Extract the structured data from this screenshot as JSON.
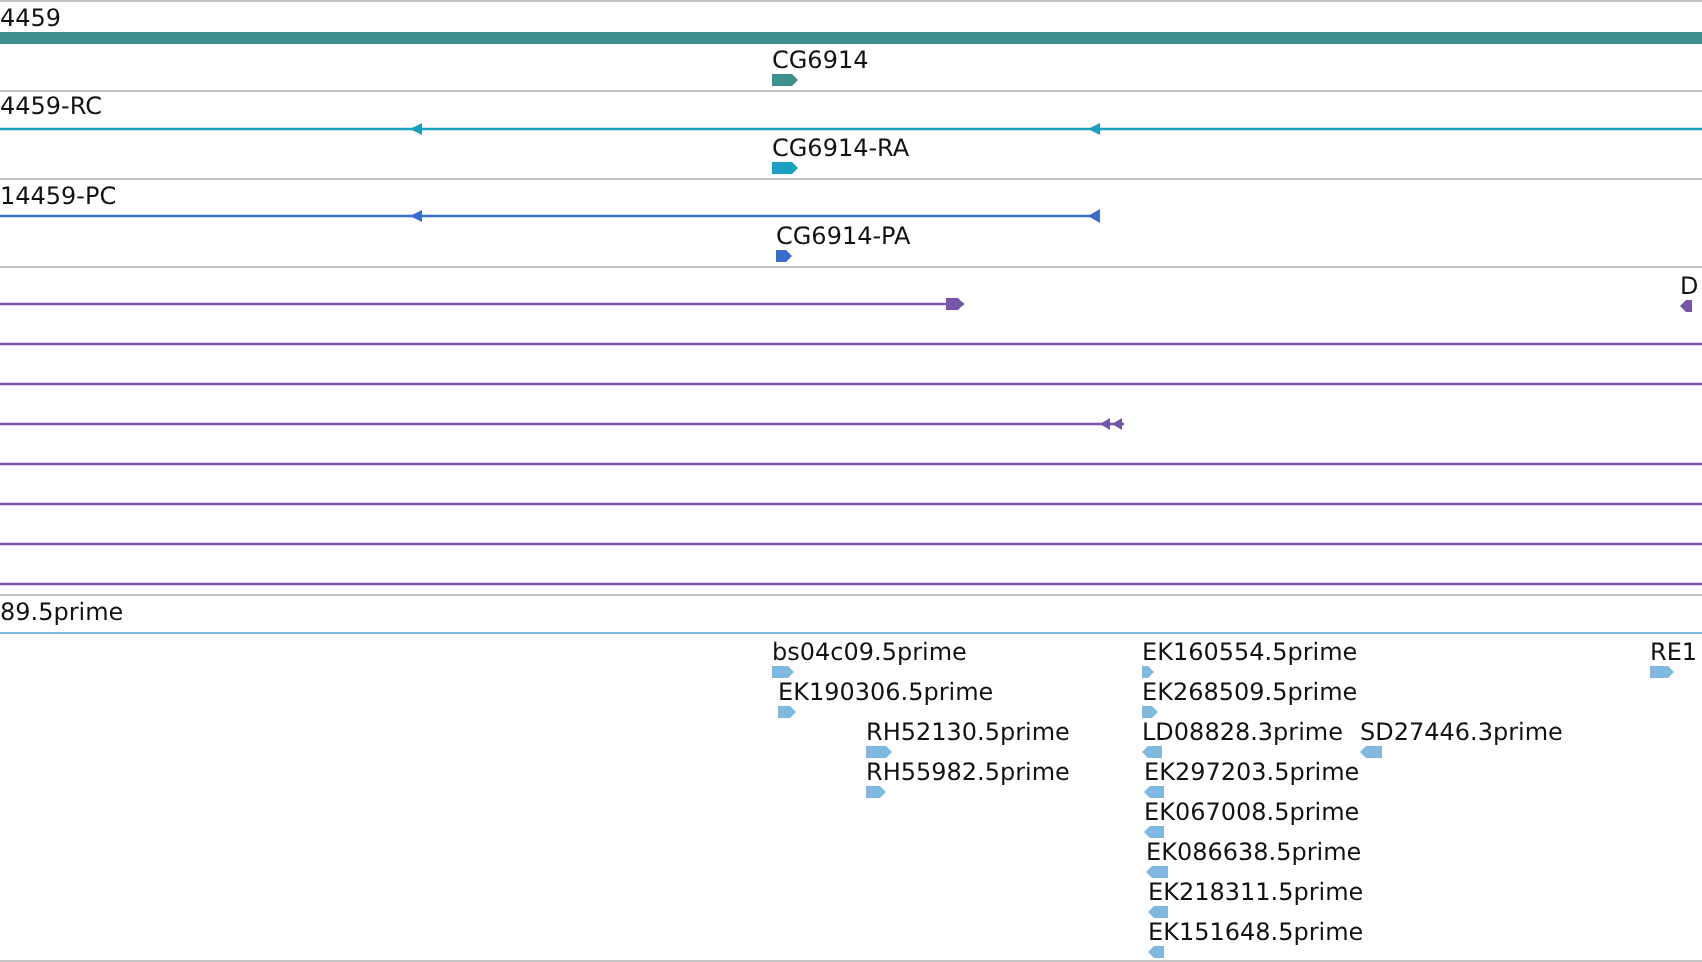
{
  "tracks": [
    {
      "kind": "gene",
      "label": "4459",
      "color": "#3f8f8f",
      "features": [
        {
          "label": "CG6914",
          "reverse": false
        }
      ]
    },
    {
      "kind": "transcript",
      "label": "4459-RC",
      "color": "#1aa0c0",
      "features": [
        {
          "label": "CG6914-RA",
          "reverse": false
        }
      ]
    },
    {
      "kind": "protein",
      "label": "14459-PC",
      "color": "#3a6ccc",
      "features": [
        {
          "label": "CG6914-PA",
          "reverse": false
        }
      ]
    },
    {
      "kind": "alignment",
      "color": "#7755aa",
      "features": [
        {
          "label": "D",
          "reverse": true
        }
      ]
    },
    {
      "kind": "est",
      "label": "89.5prime",
      "color": "#80b8e0",
      "features": [
        {
          "label": "bs04c09.5prime",
          "reverse": false
        },
        {
          "label": "EK190306.5prime",
          "reverse": false
        },
        {
          "label": "RH52130.5prime",
          "reverse": false
        },
        {
          "label": "RH55982.5prime",
          "reverse": false
        },
        {
          "label": "EK160554.5prime",
          "reverse": false
        },
        {
          "label": "EK268509.5prime",
          "reverse": false
        },
        {
          "label": "LD08828.3prime",
          "reverse": true
        },
        {
          "label": "SD27446.3prime",
          "reverse": true
        },
        {
          "label": "EK297203.5prime",
          "reverse": true
        },
        {
          "label": "EK067008.5prime",
          "reverse": true
        },
        {
          "label": "EK086638.5prime",
          "reverse": true
        },
        {
          "label": "EK218311.5prime",
          "reverse": true
        },
        {
          "label": "EK151648.5prime",
          "reverse": true
        },
        {
          "label": "RE1",
          "reverse": false
        }
      ]
    }
  ]
}
